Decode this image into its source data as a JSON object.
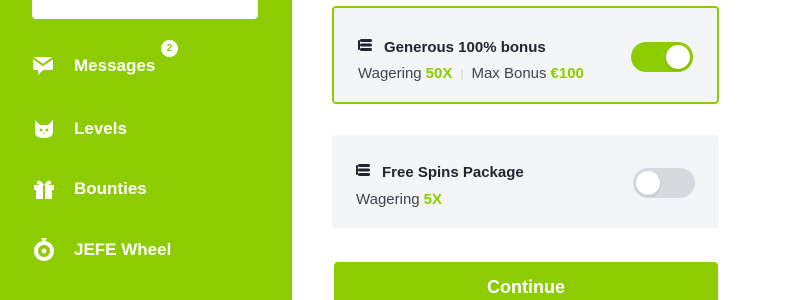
{
  "sidebar": {
    "items": [
      {
        "label": "Messages",
        "icon": "message-icon",
        "badge": "2"
      },
      {
        "label": "Levels",
        "icon": "cat-icon"
      },
      {
        "label": "Bounties",
        "icon": "gift-icon"
      },
      {
        "label": "JEFE Wheel",
        "icon": "wheel-icon"
      }
    ]
  },
  "bonuses": [
    {
      "title": "Generous 100% bonus",
      "icon": "coins-icon",
      "wagering_label": "Wagering",
      "wagering_value": "50X",
      "max_label": "Max Bonus",
      "max_value": "€100",
      "enabled": true
    },
    {
      "title": "Free Spins Package",
      "icon": "coins-icon",
      "wagering_label": "Wagering",
      "wagering_value": "5X",
      "enabled": false
    }
  ],
  "continue_label": "Continue",
  "colors": {
    "accent": "#8ccc00",
    "card_bg": "#f4f5f7",
    "toggle_off": "#d6d9de"
  }
}
